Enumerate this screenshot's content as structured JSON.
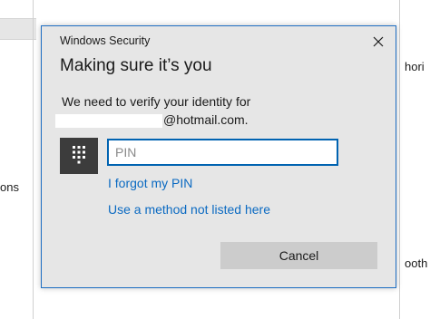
{
  "background": {
    "left_text": "ons",
    "right_text_1": "hori",
    "right_text_2": "ooth"
  },
  "dialog": {
    "title": "Windows Security",
    "close_symbol": "✕",
    "heading": "Making sure it’s you",
    "message_line1": "We need to verify your identity for",
    "message_email_suffix": "@hotmail.com.",
    "pin_placeholder": "PIN",
    "pin_value": "",
    "forgot_pin_link": "I forgot my PIN",
    "other_method_link": "Use a method not listed here",
    "cancel_label": "Cancel",
    "keypad_icon": "keypad-icon",
    "accent_color": "#1f6fc3",
    "link_color": "#0b6ac2"
  }
}
